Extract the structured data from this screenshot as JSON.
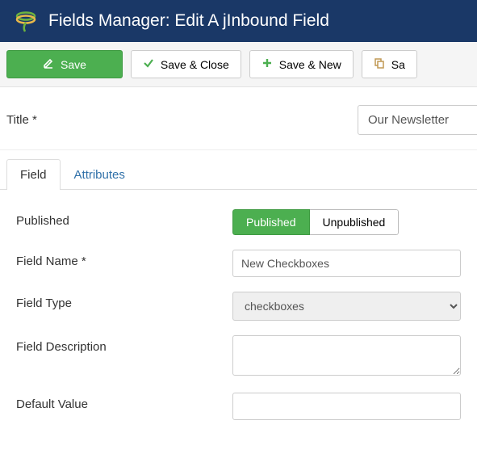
{
  "header": {
    "title": "Fields Manager: Edit A jInbound Field"
  },
  "toolbar": {
    "save": "Save",
    "save_close": "Save & Close",
    "save_new": "Save & New",
    "save_copy": "Sa"
  },
  "title_field": {
    "label": "Title *",
    "value": "Our Newsletter"
  },
  "tabs": {
    "field": "Field",
    "attributes": "Attributes"
  },
  "form": {
    "published": {
      "label": "Published",
      "option_published": "Published",
      "option_unpublished": "Unpublished"
    },
    "field_name": {
      "label": "Field Name *",
      "value": "New Checkboxes"
    },
    "field_type": {
      "label": "Field Type",
      "value": "checkboxes"
    },
    "field_description": {
      "label": "Field Description",
      "value": ""
    },
    "default_value": {
      "label": "Default Value",
      "value": ""
    }
  }
}
